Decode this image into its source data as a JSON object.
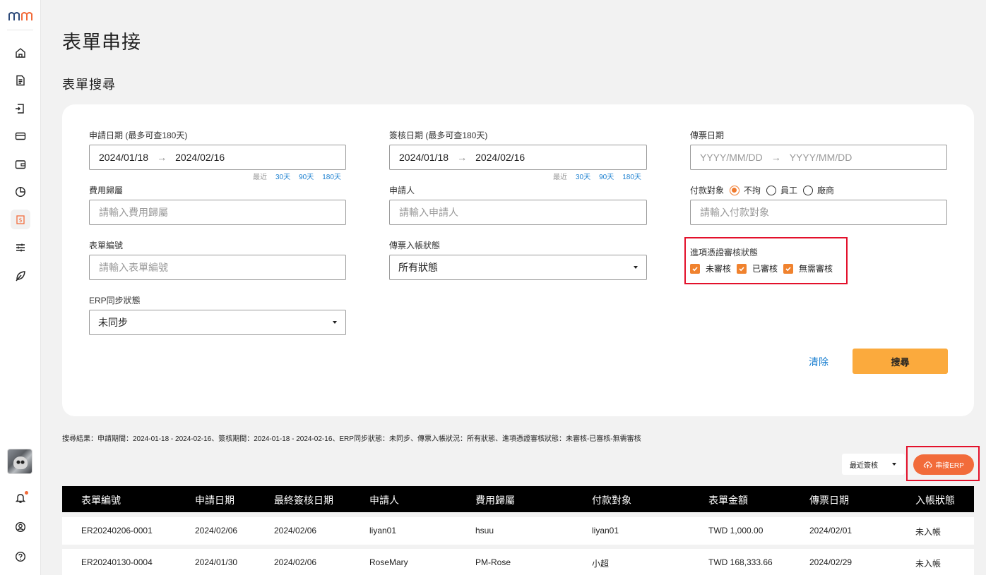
{
  "page": {
    "title": "表單串接",
    "section_title": "表單搜尋"
  },
  "sidebar": {
    "logo": "MM logo",
    "items": [
      {
        "icon": "home-icon"
      },
      {
        "icon": "document-icon"
      },
      {
        "icon": "form-transfer-icon"
      },
      {
        "icon": "card-icon"
      },
      {
        "icon": "wallet-icon"
      },
      {
        "icon": "pie-chart-icon"
      },
      {
        "icon": "money-sync-icon",
        "active": true
      },
      {
        "icon": "sliders-icon"
      },
      {
        "icon": "leaf-icon"
      }
    ],
    "bottom": [
      {
        "icon": "bell-icon"
      },
      {
        "icon": "user-circle-icon"
      },
      {
        "icon": "help-icon"
      }
    ]
  },
  "form": {
    "apply_date": {
      "label": "申請日期 (最多可查180天)",
      "start": "2024/01/18",
      "end": "2024/02/16"
    },
    "sign_date": {
      "label": "簽核日期 (最多可查180天)",
      "start": "2024/01/18",
      "end": "2024/02/16"
    },
    "voucher_date": {
      "label": "傳票日期",
      "start_placeholder": "YYYY/MM/DD",
      "end_placeholder": "YYYY/MM/DD"
    },
    "quick_range": {
      "label": "最近",
      "d30": "30天",
      "d90": "90天",
      "d180": "180天"
    },
    "expense_owner": {
      "label": "費用歸屬",
      "placeholder": "請輸入費用歸屬"
    },
    "applicant": {
      "label": "申請人",
      "placeholder": "請輸入申請人"
    },
    "payee": {
      "label": "付款對象",
      "placeholder": "請輸入付款對象",
      "options": [
        "不拘",
        "員工",
        "廠商"
      ],
      "selected": "不拘"
    },
    "form_no": {
      "label": "表單編號",
      "placeholder": "請輸入表單編號"
    },
    "voucher_status": {
      "label": "傳票入帳狀態",
      "value": "所有狀態"
    },
    "review_status": {
      "label": "進項憑證審核狀態",
      "options": [
        "未審核",
        "已審核",
        "無需審核"
      ]
    },
    "erp_status": {
      "label": "ERP同步狀態",
      "value": "未同步"
    },
    "clear_label": "清除",
    "search_label": "搜尋"
  },
  "results": {
    "summary": "搜尋結果：申請期間：2024-01-18 - 2024-02-16、簽核期間：2024-01-18 - 2024-02-16、ERP同步狀態：未同步、傳票入帳狀況：所有狀態、進項憑證審核狀態：未審核-已審核-無需審核",
    "sort_value": "最近簽核",
    "erp_button": "串接ERP"
  },
  "table": {
    "headers": [
      "表單編號",
      "申請日期",
      "最終簽核日期",
      "申請人",
      "費用歸屬",
      "付款對象",
      "表單金額",
      "傳票日期",
      "入帳狀態"
    ],
    "rows": [
      [
        "ER20240206-0001",
        "2024/02/06",
        "2024/02/06",
        "liyan01",
        "hsuu",
        "liyan01",
        "TWD 1,000.00",
        "2024/02/01",
        "未入帳"
      ],
      [
        "ER20240130-0004",
        "2024/01/30",
        "2024/02/06",
        "RoseMary",
        "PM-Rose",
        "小超",
        "TWD 168,333.66",
        "2024/02/29",
        "未入帳"
      ]
    ]
  },
  "colors": {
    "accent": "#fbaa3d",
    "erp_button": "#f26b3a",
    "link": "#1a7fd0",
    "highlight_box": "#e3112b"
  }
}
